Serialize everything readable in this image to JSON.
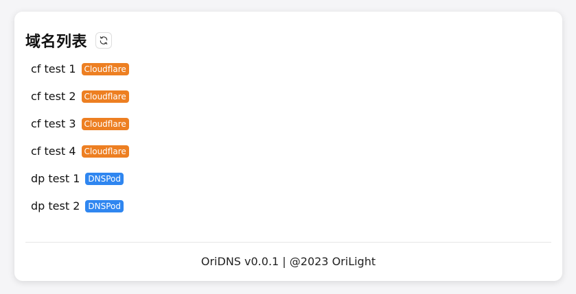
{
  "header": {
    "title": "域名列表",
    "refresh_icon": "refresh-icon"
  },
  "domains": [
    {
      "name": "cf test 1",
      "provider": "Cloudflare",
      "provider_color": "#ed7f22"
    },
    {
      "name": "cf test 2",
      "provider": "Cloudflare",
      "provider_color": "#ed7f22"
    },
    {
      "name": "cf test 3",
      "provider": "Cloudflare",
      "provider_color": "#ed7f22"
    },
    {
      "name": "cf test 4",
      "provider": "Cloudflare",
      "provider_color": "#ed7f22"
    },
    {
      "name": "dp test 1",
      "provider": "DNSPod",
      "provider_color": "#2f86f0"
    },
    {
      "name": "dp test 2",
      "provider": "DNSPod",
      "provider_color": "#2f86f0"
    }
  ],
  "footer": {
    "text": "OriDNS v0.0.1 | @2023 OriLight"
  }
}
